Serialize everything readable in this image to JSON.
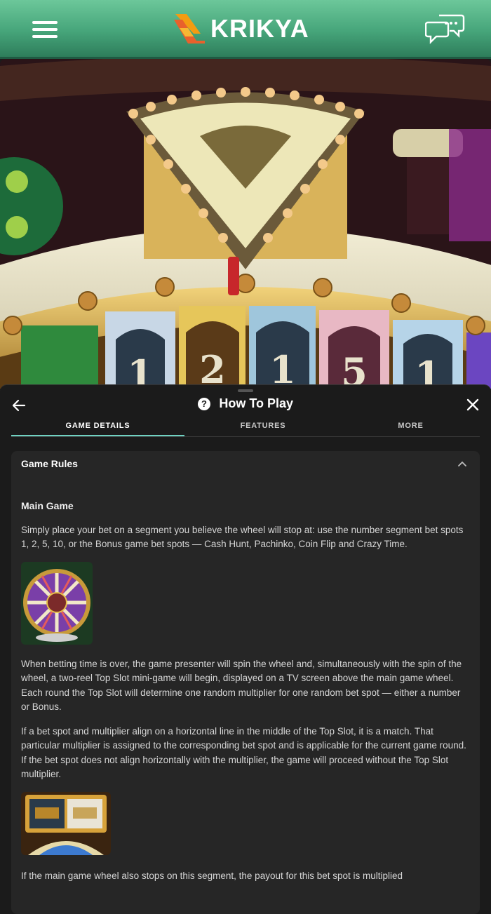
{
  "header": {
    "brand": "KRIKYA",
    "menu_icon": "hamburger-menu-icon",
    "chat_icon": "chat-bubbles-icon",
    "brand_color": "#4caf83"
  },
  "stream": {
    "wheel_numbers": [
      "1",
      "2",
      "1",
      "5",
      "1"
    ]
  },
  "panel": {
    "title": "How To Play",
    "tabs": [
      "GAME DETAILS",
      "FEATURES",
      "MORE"
    ],
    "active_tab": "GAME DETAILS",
    "accent": "#6fd2c2",
    "section": {
      "title": "Game Rules",
      "subheading": "Main Game",
      "paragraphs": [
        "Simply place your bet on a segment you believe the wheel will stop at: use the number segment bet spots 1, 2, 5, 10, or the Bonus game bet spots — Cash Hunt, Pachinko, Coin Flip and Crazy Time.",
        "When betting time is over, the game presenter will spin the wheel and, simultaneously with the spin of the wheel, a two-reel Top Slot mini-game will begin, displayed on a TV screen above the main game wheel. Each round the Top Slot will determine one random multiplier for one random bet spot — either a number or Bonus.",
        "If a bet spot and multiplier align on a horizontal line in the middle of the Top Slot, it is a match. That particular multiplier is assigned to the corresponding bet spot and is applicable for the current game round. If the bet spot does not align horizontally with the multiplier, the game will proceed without the Top Slot multiplier.",
        "If the main game wheel also stops on this segment, the payout for this bet spot is multiplied"
      ]
    }
  }
}
